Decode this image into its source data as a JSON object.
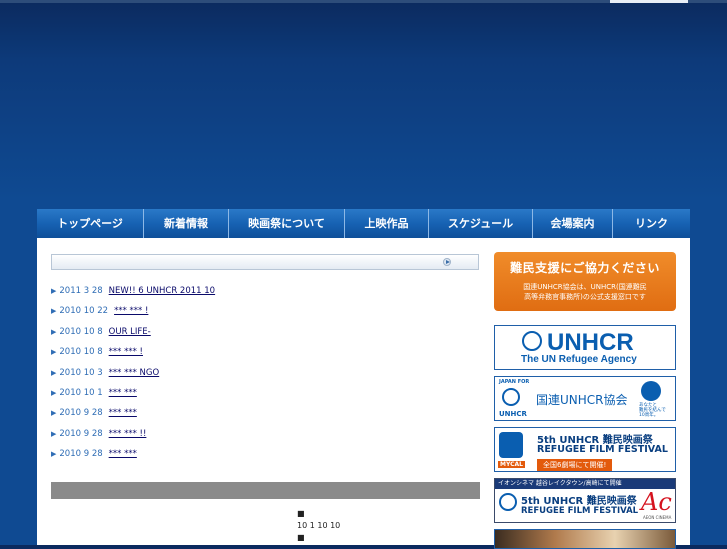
{
  "nav": {
    "items": [
      {
        "label": "トップページ"
      },
      {
        "label": "新着情報"
      },
      {
        "label": "映画祭について"
      },
      {
        "label": "上映作品"
      },
      {
        "label": "スケジュール"
      },
      {
        "label": "会場案内"
      },
      {
        "label": "リンク"
      }
    ]
  },
  "news": [
    {
      "date": "2011 3 28",
      "title": "NEW!! 6 UNHCR     2011 10"
    },
    {
      "date": "2010 10 22",
      "title": "***   ***         !"
    },
    {
      "date": "2010 10 8",
      "title": "OUR LIFE-"
    },
    {
      "date": "2010 10 8",
      "title": "***   ***             !"
    },
    {
      "date": "2010 10 3",
      "title": "***   ***        NGO"
    },
    {
      "date": "2010 10 1",
      "title": "***   ***"
    },
    {
      "date": "2010 9 28",
      "title": "***   ***"
    },
    {
      "date": "2010 9 28",
      "title": "***   ***         !!"
    },
    {
      "date": "2010 9 28",
      "title": "***   ***"
    }
  ],
  "notice": {
    "bullet1": "■",
    "line1": "10 1     10 10",
    "bullet2": "■"
  },
  "sidebar": {
    "support_title": "難民支援にご協力ください",
    "support_sub1": "国連UNHCR協会は、UNHCR(国連難民",
    "support_sub2": "高等弁務官事務所)の公式支援窓口です",
    "unhcr_word": "UNHCR",
    "unhcr_sub": "The UN Refugee Agency",
    "japan_for": "JAPAN FOR",
    "japan_unhcr": "UNHCR",
    "japan_assoc": "国連UNHCR協会",
    "japan_small1": "あなたと",
    "japan_small2": "難民を結んで",
    "japan_small3": "10周年。",
    "fest5_line1": "5th UNHCR 難民映画祭",
    "fest5_line2": "REFUGEE FILM FESTIVAL",
    "fest5_line3": "全国6劇場にて開催!",
    "fest5_mycal": "MYCAL",
    "aeon_head": "イオンシネマ 越谷レイクタウン/高崎にて開催",
    "aeon_line1": "5th UNHCR 難民映画祭",
    "aeon_line2": "REFUGEE FILM FESTIVAL",
    "aeon_ac": "Ac",
    "aeon_brand": "AEON CINEMA"
  },
  "colors": {
    "nav": "#1762b3",
    "accent_orange": "#e06d12",
    "unhcr_blue": "#0a5eb0"
  }
}
